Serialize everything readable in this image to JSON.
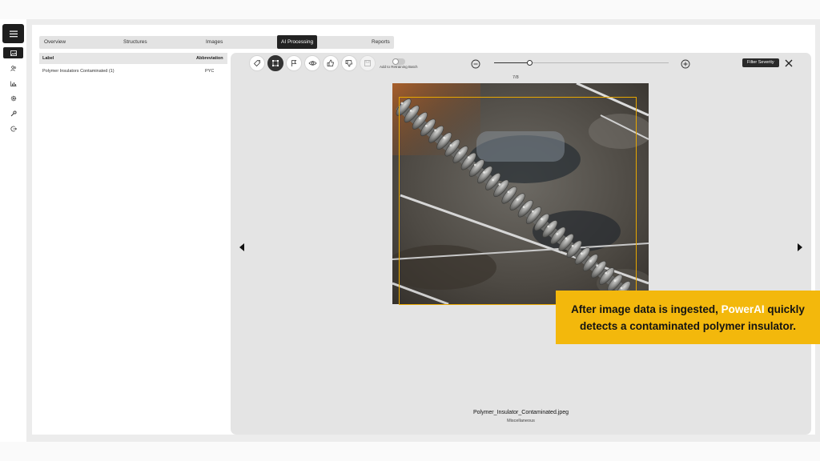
{
  "nav": {
    "menu_icon": "menu-icon",
    "items": [
      {
        "icon": "image-icon",
        "active": true
      },
      {
        "icon": "users-icon",
        "active": false
      },
      {
        "icon": "chart-icon",
        "active": false
      },
      {
        "icon": "gear-icon",
        "active": false
      },
      {
        "icon": "wrench-icon",
        "active": false
      },
      {
        "icon": "logout-icon",
        "active": false
      }
    ]
  },
  "tabs": [
    {
      "label": "Overview",
      "active": false
    },
    {
      "label": "Structures",
      "active": false
    },
    {
      "label": "Images",
      "active": false
    },
    {
      "label": "AI Processing",
      "active": true
    },
    {
      "label": "Reports",
      "active": false
    }
  ],
  "table": {
    "headers": {
      "label": "Label",
      "abbreviation": "Abbreviation"
    },
    "rows": [
      {
        "label": "Polymer Insulators Contaminated (1)",
        "abbreviation": "PYC"
      }
    ]
  },
  "toolbar": {
    "tools": [
      {
        "icon": "tag-icon",
        "active": false
      },
      {
        "icon": "bounding-box-icon",
        "active": true
      },
      {
        "icon": "flag-icon",
        "active": false
      },
      {
        "icon": "eye-icon",
        "active": false
      },
      {
        "icon": "thumbs-up-icon",
        "active": false
      },
      {
        "icon": "thumbs-down-icon",
        "active": false
      },
      {
        "icon": "save-icon",
        "active": false
      }
    ],
    "retraining_toggle_label": "Add to Retraining Batch",
    "retraining_enabled": false,
    "zoom_level": 0.2,
    "page_indicator": "7/8",
    "tooltip": "Filter Severity"
  },
  "image": {
    "filename": "Polymer_Insulator_Contaminated.jpeg",
    "category": "Miscellaneous",
    "detection_color": "#e8a700"
  },
  "caption": {
    "before": "After image data is ingested, ",
    "highlight": "PowerAI",
    "after": " quickly",
    "line2": "detects a contaminated polymer insulator.",
    "background": "#f3b80c"
  }
}
